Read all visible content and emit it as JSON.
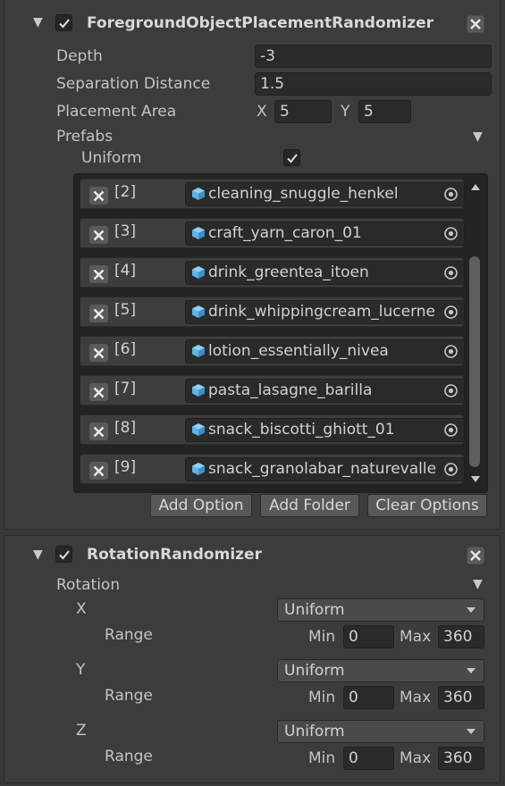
{
  "foreground": {
    "title": "ForegroundObjectPlacementRandomizer",
    "enabled": true,
    "depth": {
      "label": "Depth",
      "value": "-3"
    },
    "separation": {
      "label": "Separation Distance",
      "value": "1.5"
    },
    "placement": {
      "label": "Placement Area",
      "x_label": "X",
      "x_value": "5",
      "y_label": "Y",
      "y_value": "5"
    },
    "prefabs": {
      "label": "Prefabs",
      "uniform_label": "Uniform",
      "uniform_checked": true,
      "items": [
        {
          "index": "[2]",
          "name": "cleaning_snuggle_henkel"
        },
        {
          "index": "[3]",
          "name": "craft_yarn_caron_01"
        },
        {
          "index": "[4]",
          "name": "drink_greentea_itoen"
        },
        {
          "index": "[5]",
          "name": "drink_whippingcream_lucerne"
        },
        {
          "index": "[6]",
          "name": "lotion_essentially_nivea"
        },
        {
          "index": "[7]",
          "name": "pasta_lasagne_barilla"
        },
        {
          "index": "[8]",
          "name": "snack_biscotti_ghiott_01"
        },
        {
          "index": "[9]",
          "name": "snack_granolabar_naturevalley"
        }
      ],
      "buttons": {
        "add_option": "Add Option",
        "add_folder": "Add Folder",
        "clear_options": "Clear Options"
      }
    }
  },
  "rotation": {
    "title": "RotationRandomizer",
    "enabled": true,
    "label": "Rotation",
    "axes": [
      {
        "axis": "X",
        "distribution": "Uniform",
        "range_label": "Range",
        "min_label": "Min",
        "min": "0",
        "max_label": "Max",
        "max": "360"
      },
      {
        "axis": "Y",
        "distribution": "Uniform",
        "range_label": "Range",
        "min_label": "Min",
        "min": "0",
        "max_label": "Max",
        "max": "360"
      },
      {
        "axis": "Z",
        "distribution": "Uniform",
        "range_label": "Range",
        "min_label": "Min",
        "min": "0",
        "max_label": "Max",
        "max": "360"
      }
    ]
  },
  "colors": {
    "background": "#383838",
    "field": "#2a2a2a",
    "accent_cube": "#5fb3e6"
  },
  "icons": [
    "foldout-caret-icon",
    "checkbox-check-icon",
    "remove-x-icon",
    "prefab-cube-icon",
    "object-picker-icon"
  ]
}
